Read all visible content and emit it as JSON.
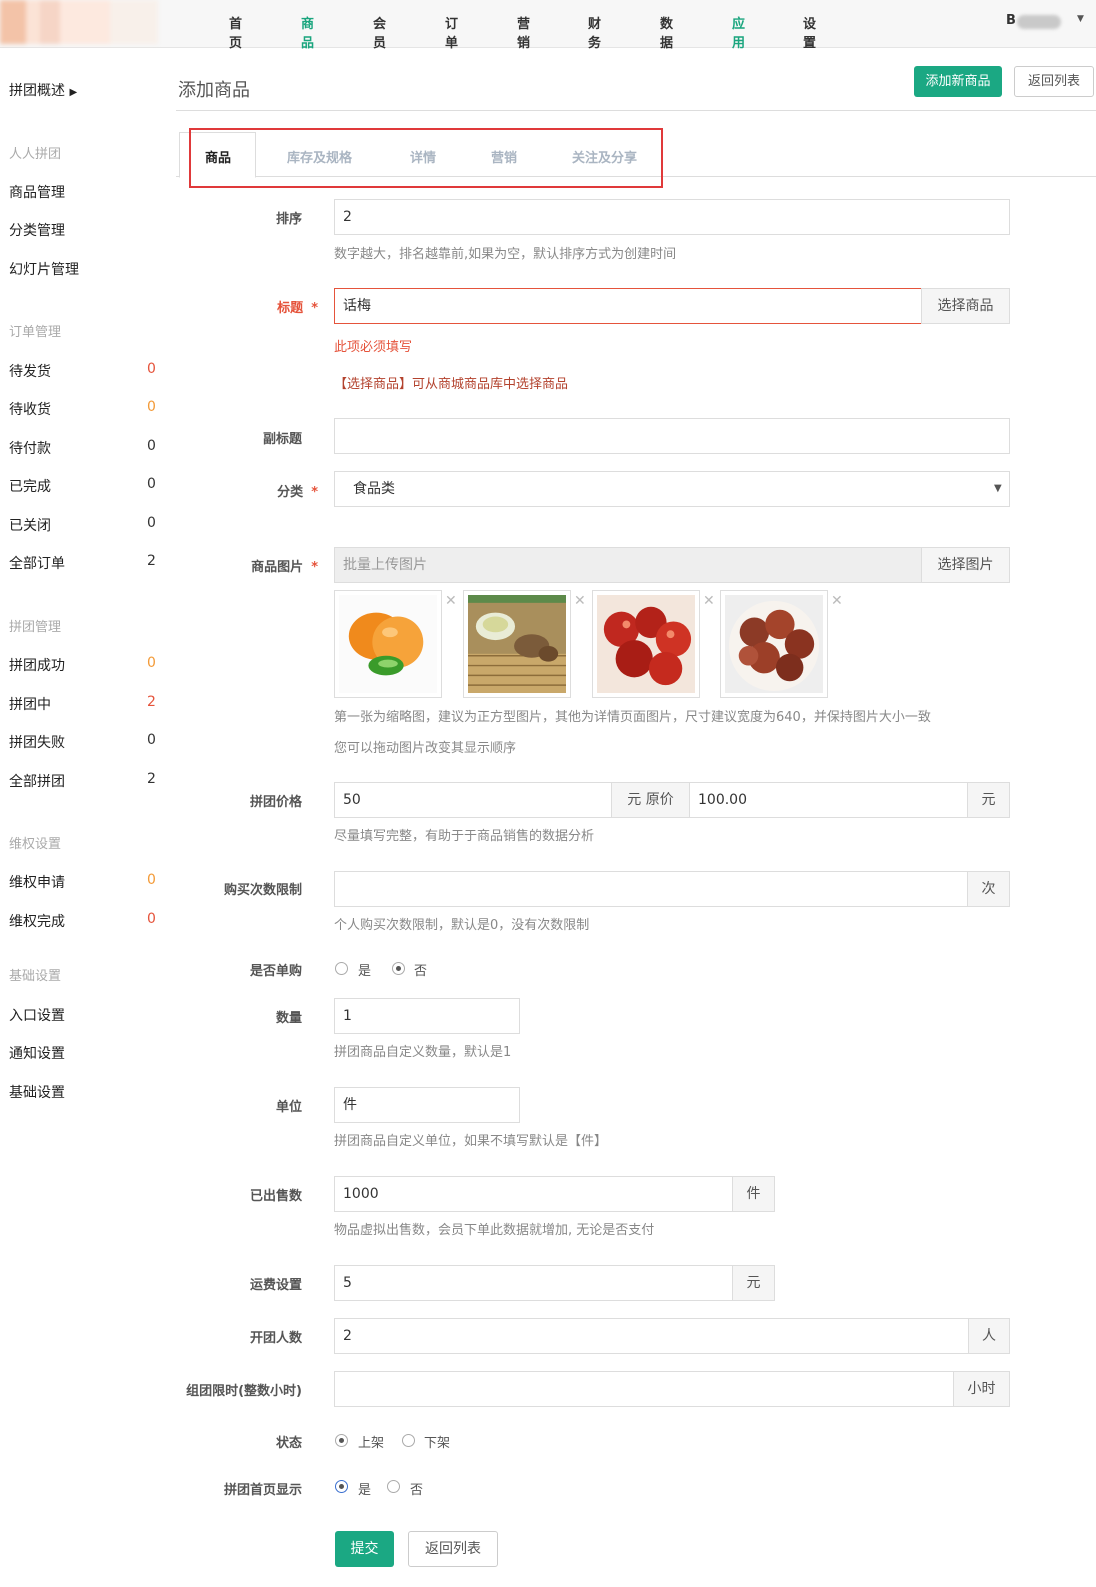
{
  "topnav": {
    "items": [
      "首页",
      "商品",
      "会员",
      "订单",
      "营销",
      "财务",
      "数据",
      "应用",
      "设置"
    ],
    "user_initial": "B"
  },
  "sidebar": {
    "overview": "拼团概述",
    "sections": [
      {
        "head": "人人拼团",
        "items": [
          {
            "label": "商品管理"
          },
          {
            "label": "分类管理"
          },
          {
            "label": "幻灯片管理"
          }
        ]
      },
      {
        "head": "订单管理",
        "items": [
          {
            "label": "待发货",
            "count": "0"
          },
          {
            "label": "待收货",
            "count": "0"
          },
          {
            "label": "待付款",
            "count": "0"
          },
          {
            "label": "已完成",
            "count": "0"
          },
          {
            "label": "已关闭",
            "count": "0"
          },
          {
            "label": "全部订单",
            "count": "2"
          }
        ]
      },
      {
        "head": "拼团管理",
        "items": [
          {
            "label": "拼团成功",
            "count": "0"
          },
          {
            "label": "拼团中",
            "count": "2"
          },
          {
            "label": "拼团失败",
            "count": "0"
          },
          {
            "label": "全部拼团",
            "count": "2"
          }
        ]
      },
      {
        "head": "维权设置",
        "items": [
          {
            "label": "维权申请",
            "count": "0"
          },
          {
            "label": "维权完成",
            "count": "0"
          }
        ]
      },
      {
        "head": "基础设置",
        "items": [
          {
            "label": "入口设置"
          },
          {
            "label": "通知设置"
          },
          {
            "label": "基础设置"
          }
        ]
      }
    ]
  },
  "page": {
    "title": "添加商品",
    "add_new_button": "添加新商品",
    "back_button": "返回列表"
  },
  "tabs": [
    "商品",
    "库存及规格",
    "详情",
    "营销",
    "关注及分享"
  ],
  "form": {
    "sort": {
      "label": "排序",
      "value": "2",
      "help": "数字越大，排名越靠前,如果为空，默认排序方式为创建时间"
    },
    "title": {
      "label": "标题",
      "value": "话梅",
      "button": "选择商品",
      "error": "此项必须填写",
      "help": "【选择商品】可从商城商品库中选择商品"
    },
    "subtitle": {
      "label": "副标题",
      "value": ""
    },
    "category": {
      "label": "分类",
      "value": "食品类"
    },
    "images": {
      "label": "商品图片",
      "placeholder": "批量上传图片",
      "button": "选择图片",
      "help1": "第一张为缩略图，建议为正方型图片，其他为详情页面图片，尺寸建议宽度为640，并保持图片大小一致",
      "help2": "您可以拖动图片改变其显示顺序",
      "close": "✕"
    },
    "price": {
      "label": "拼团价格",
      "value": "50",
      "mid_addon": "元 原价",
      "orig_value": "100.00",
      "unit": "元",
      "help": "尽量填写完整，有助于于商品销售的数据分析"
    },
    "limit": {
      "label": "购买次数限制",
      "value": "",
      "unit": "次",
      "help": "个人购买次数限制，默认是0，没有次数限制"
    },
    "single": {
      "label": "是否单购",
      "yes": "是",
      "no": "否"
    },
    "quantity": {
      "label": "数量",
      "value": "1",
      "help": "拼团商品自定义数量，默认是1"
    },
    "unit": {
      "label": "单位",
      "value": "件",
      "help": "拼团商品自定义单位，如果不填写默认是【件】"
    },
    "sold": {
      "label": "已出售数",
      "value": "1000",
      "unit": "件",
      "help": "物品虚拟出售数，会员下单此数据就增加, 无论是否支付"
    },
    "freight": {
      "label": "运费设置",
      "value": "5",
      "unit": "元"
    },
    "group_size": {
      "label": "开团人数",
      "value": "2",
      "unit": "人"
    },
    "time_limit": {
      "label": "组团限时(整数小时)",
      "value": "",
      "unit": "小时"
    },
    "status": {
      "label": "状态",
      "on": "上架",
      "off": "下架"
    },
    "home_show": {
      "label": "拼团首页显示",
      "yes": "是",
      "no": "否"
    },
    "submit": "提交",
    "back": "返回列表"
  },
  "colors": {
    "accent": "#1ba883",
    "error": "#e5533b",
    "highlight": "#e0393a"
  }
}
